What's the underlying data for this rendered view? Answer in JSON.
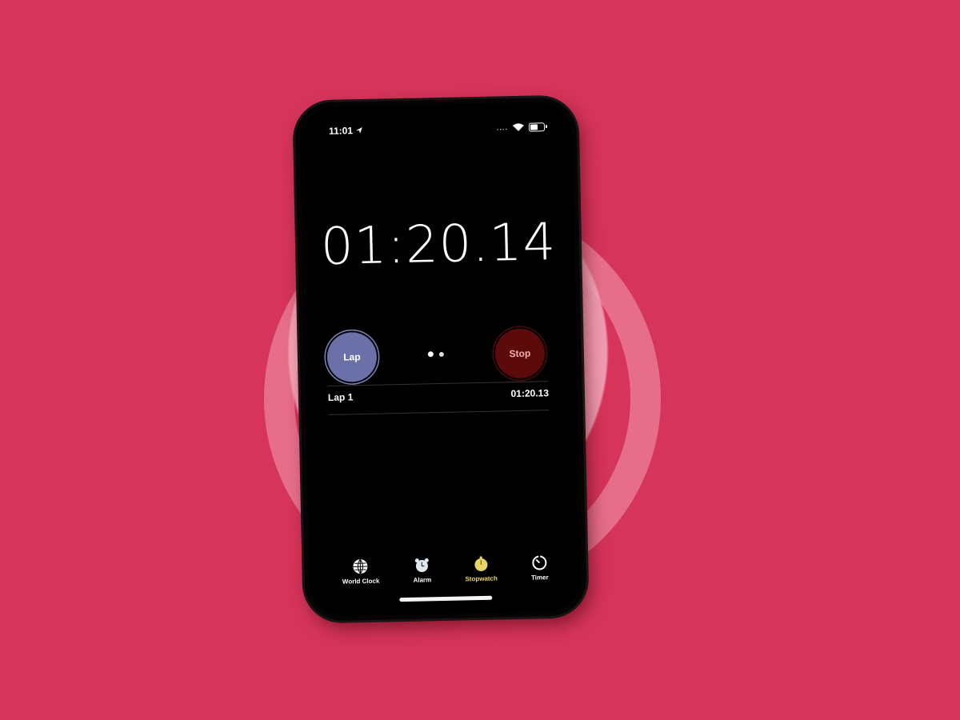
{
  "status_bar": {
    "time": "11:01",
    "signal_dots": "....",
    "icons": [
      "location-arrow-icon",
      "wifi-icon",
      "battery-icon"
    ]
  },
  "stopwatch": {
    "elapsed": "01:20.14",
    "lap_button_label": "Lap",
    "stop_button_label": "Stop",
    "page_count": 2,
    "active_page": 1
  },
  "laps": [
    {
      "label": "Lap 1",
      "time": "01:20.13"
    }
  ],
  "tabbar": {
    "items": [
      {
        "label": "World Clock",
        "icon": "globe-icon",
        "active": false
      },
      {
        "label": "Alarm",
        "icon": "alarm-clock-icon",
        "active": false
      },
      {
        "label": "Stopwatch",
        "icon": "stopwatch-icon",
        "active": true
      },
      {
        "label": "Timer",
        "icon": "timer-icon",
        "active": false
      }
    ]
  },
  "colors": {
    "active_tab": "#e8d56a",
    "lap_button": "#6b70a8",
    "stop_button": "#5c0a0a",
    "stop_text": "#f2b0a8"
  }
}
